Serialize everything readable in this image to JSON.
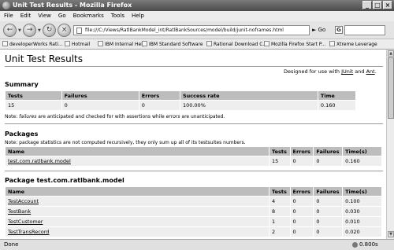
{
  "window": {
    "title": "Unit Test Results - Mozilla Firefox",
    "buttons": [
      "_",
      "□",
      "×"
    ]
  },
  "menu": [
    "File",
    "Edit",
    "View",
    "Go",
    "Bookmarks",
    "Tools",
    "Help"
  ],
  "nav": {
    "url": "file:///C:/Views/RatlBankModel_int/RatlBankSources/model/build/junit-noframes.html",
    "go_label": "Go",
    "search_icon": "G"
  },
  "bookmarks": [
    "developerWorks  Rati...",
    "Hotmail",
    "IBM Internal Help",
    "IBM Standard Software",
    "Rational Download C...",
    "Mozilla Firefox Start P...",
    "Xtreme Leverage"
  ],
  "page": {
    "title": "Unit Test Results",
    "designed_prefix": "Designed for use with ",
    "junit_link": "JUnit",
    "and_text": " and ",
    "ant_link": "Ant",
    "period": "."
  },
  "summary": {
    "heading": "Summary",
    "headers": [
      "Tests",
      "Failures",
      "Errors",
      "Success rate",
      "Time"
    ],
    "row": [
      "15",
      "0",
      "0",
      "100.00%",
      "0.160"
    ],
    "note_parts": [
      "Note: ",
      "failures",
      " are anticipated and checked for with assertions while ",
      "errors",
      " are unanticipated."
    ]
  },
  "packages": {
    "heading": "Packages",
    "note": "Note: package statistics are not computed recursively, they only sum up all of its testsuites numbers.",
    "headers": [
      "Name",
      "Tests",
      "Errors",
      "Failures",
      "Time(s)"
    ],
    "rows": [
      {
        "name": "test.com.ratlbank.model",
        "tests": "15",
        "errors": "0",
        "failures": "0",
        "time": "0.160"
      }
    ]
  },
  "package_detail": {
    "heading": "Package test.com.ratlbank.model",
    "headers": [
      "Name",
      "Tests",
      "Errors",
      "Failures",
      "Time(s)"
    ],
    "rows": [
      {
        "name": "TestAccount",
        "tests": "4",
        "errors": "0",
        "failures": "0",
        "time": "0.100"
      },
      {
        "name": "TestBank",
        "tests": "8",
        "errors": "0",
        "failures": "0",
        "time": "0.030"
      },
      {
        "name": "TestCustomer",
        "tests": "1",
        "errors": "0",
        "failures": "0",
        "time": "0.010"
      },
      {
        "name": "TestTransRecord",
        "tests": "2",
        "errors": "0",
        "failures": "0",
        "time": "0.020"
      }
    ]
  },
  "status": {
    "text": "Done",
    "timer": "0.800s"
  }
}
